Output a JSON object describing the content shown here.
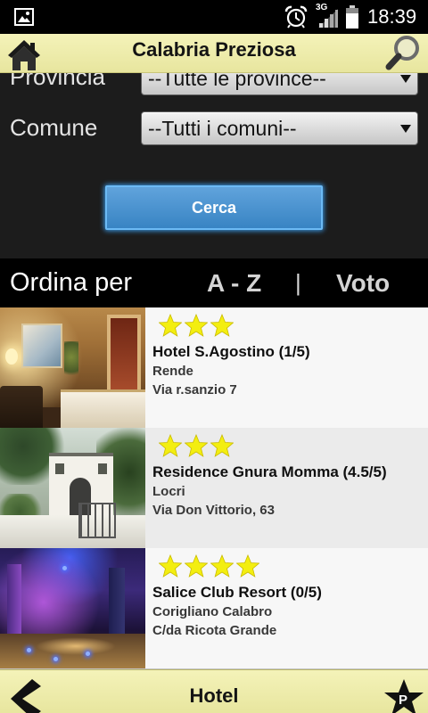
{
  "status_bar": {
    "network": "3G",
    "time": "18:39",
    "icons": [
      "picture-icon",
      "alarm-clock-icon",
      "signal-icon",
      "battery-icon"
    ]
  },
  "header": {
    "title": "Calabria Preziosa",
    "home_icon": "home-icon",
    "search_icon": "search-icon"
  },
  "filters": {
    "provincia": {
      "label": "Provincia",
      "selected": "--Tutte le province--"
    },
    "comune": {
      "label": "Comune",
      "selected": "--Tutti i comuni--"
    },
    "dropdown_icon": "dropdown-arrow-icon",
    "search_button": "Cerca"
  },
  "sort": {
    "label": "Ordina per",
    "options": [
      "A - Z",
      "Voto"
    ],
    "separator": "|"
  },
  "hotels": [
    {
      "name": "Hotel S.Agostino (1/5)",
      "city": "Rende",
      "address": "Via r.sanzio 7",
      "stars": 3
    },
    {
      "name": "Residence Gnura Momma (4.5/5)",
      "city": "Locri",
      "address": "Via Don Vittorio, 63",
      "stars": 3
    },
    {
      "name": "Salice Club Resort (0/5)",
      "city": "Corigliano Calabro",
      "address": "C/da Ricota Grande",
      "stars": 4
    }
  ],
  "footer": {
    "title": "Hotel",
    "badge_letter": "P",
    "back_icon": "back-arrow-icon",
    "badge_icon": "star-badge-icon"
  },
  "colors": {
    "bar": "#f1efa5",
    "button": "#3d8fd4",
    "star": "#f3ee10"
  }
}
